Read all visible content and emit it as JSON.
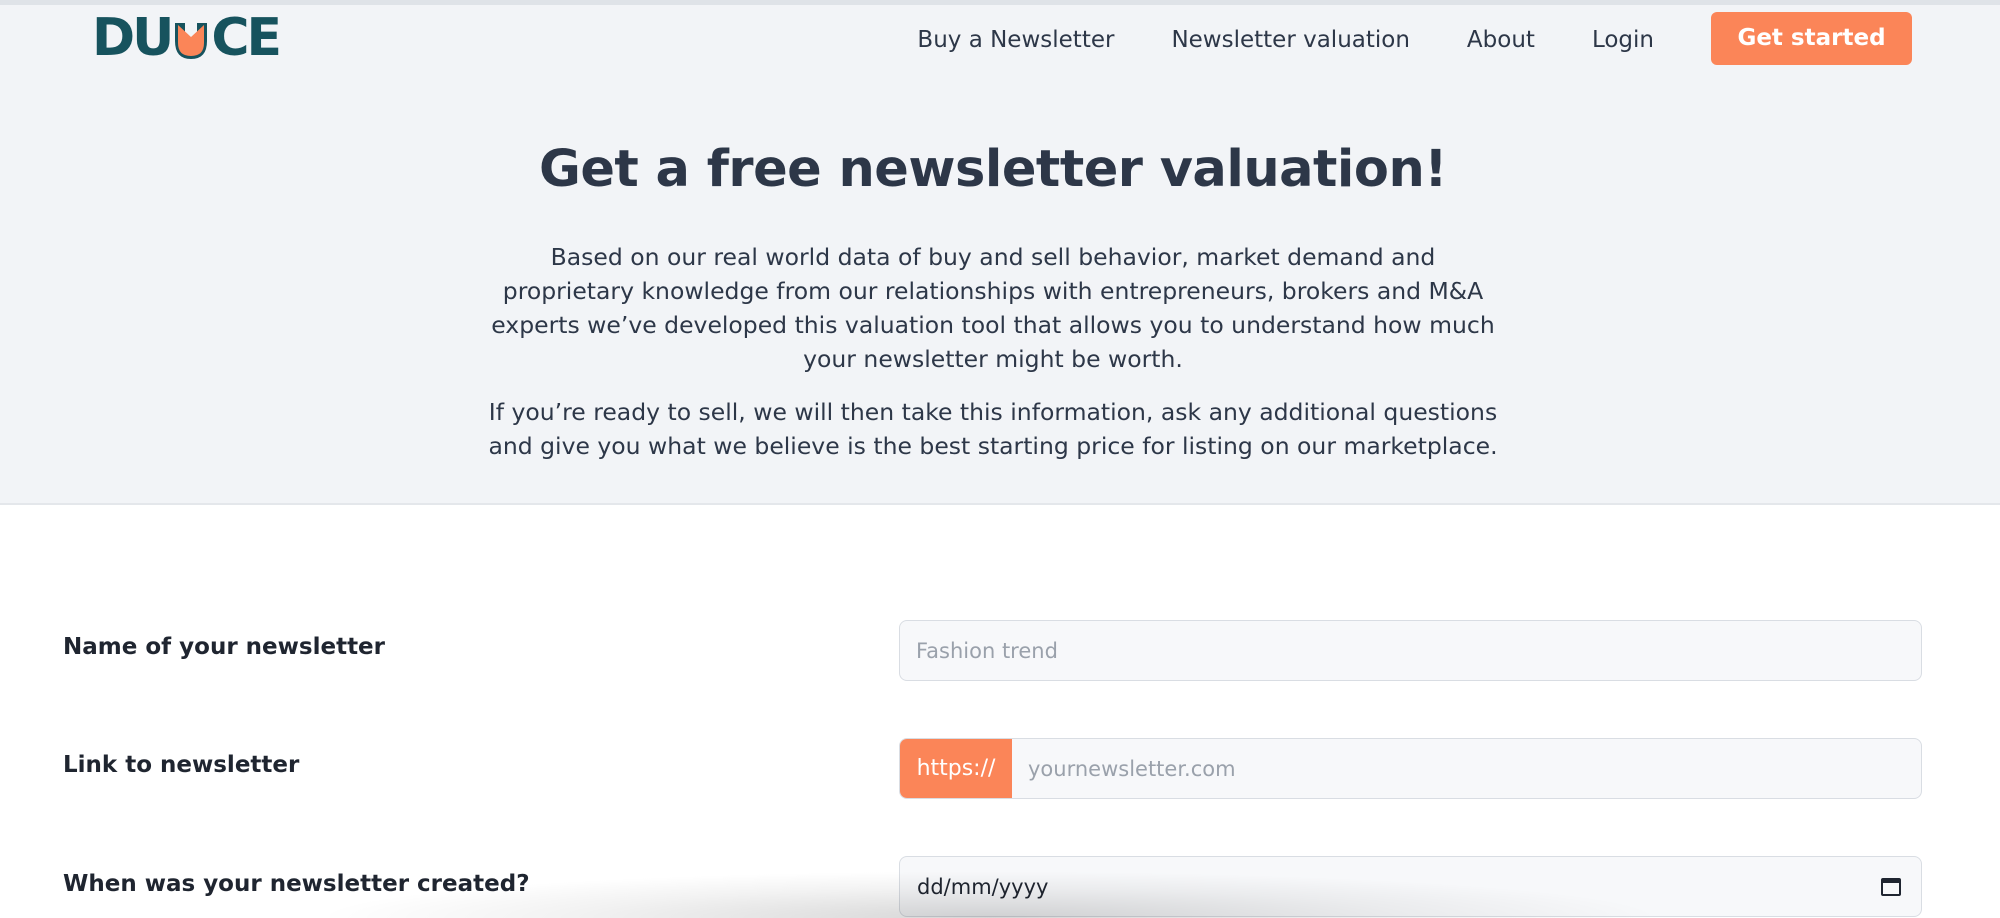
{
  "brand": {
    "logo_text": "DUCE",
    "logo_left": "DU",
    "logo_right": "CE",
    "primary_color": "#17535e",
    "accent_color": "#fb8558"
  },
  "nav": {
    "links": [
      "Buy a Newsletter",
      "Newsletter valuation",
      "About",
      "Login"
    ],
    "cta_label": "Get started"
  },
  "hero": {
    "title": "Get a free newsletter valuation!",
    "paragraph_1": "Based on our real world data of buy and sell behavior, market demand and proprietary knowledge from our relationships with entrepreneurs, brokers and M&A experts we’ve developed this valuation tool that allows you to understand how much your newsletter might be worth.",
    "paragraph_2": "If you’re ready to sell, we will then take this information, ask any additional questions and give you what we believe is the best starting price for listing on our marketplace."
  },
  "form": {
    "name_label": "Name of your newsletter",
    "name_placeholder": "Fashion trend",
    "link_label": "Link to newsletter",
    "link_prefix": "https://",
    "link_placeholder": "yournewsletter.com",
    "created_label": "When was your newsletter created?",
    "created_value": "dd/mm/yyyy",
    "calendar_icon": "calendar-icon"
  }
}
